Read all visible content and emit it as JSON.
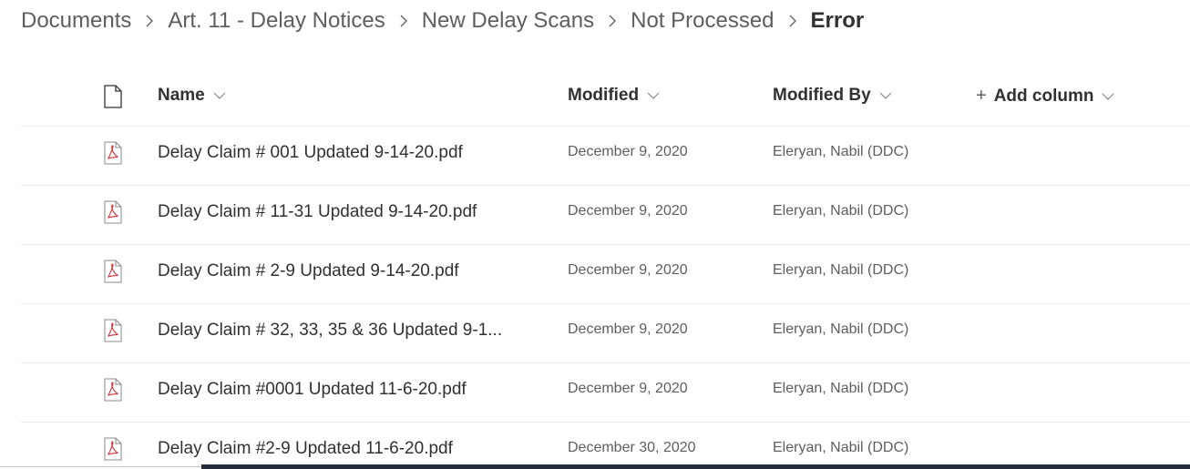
{
  "breadcrumb": {
    "items": [
      "Documents",
      "Art. 11 - Delay Notices",
      "New Delay Scans",
      "Not Processed"
    ],
    "current": "Error"
  },
  "columns": {
    "name": "Name",
    "modified": "Modified",
    "modified_by": "Modified By",
    "add_column": "Add column"
  },
  "icons": {
    "file_header": "document-icon",
    "row_file": "pdf-icon",
    "pdf_accent": "#d13438"
  },
  "rows": [
    {
      "name": "Delay Claim # 001 Updated 9-14-20.pdf",
      "modified": "December 9, 2020",
      "modified_by": "Eleryan, Nabil (DDC)"
    },
    {
      "name": "Delay Claim # 11-31 Updated 9-14-20.pdf",
      "modified": "December 9, 2020",
      "modified_by": "Eleryan, Nabil (DDC)"
    },
    {
      "name": "Delay Claim # 2-9 Updated 9-14-20.pdf",
      "modified": "December 9, 2020",
      "modified_by": "Eleryan, Nabil (DDC)"
    },
    {
      "name": "Delay Claim # 32, 33, 35 & 36 Updated 9-1...",
      "modified": "December 9, 2020",
      "modified_by": "Eleryan, Nabil (DDC)"
    },
    {
      "name": "Delay Claim #0001 Updated 11-6-20.pdf",
      "modified": "December 9, 2020",
      "modified_by": "Eleryan, Nabil (DDC)"
    },
    {
      "name": "Delay Claim #2-9 Updated 11-6-20.pdf",
      "modified": "December 30, 2020",
      "modified_by": "Eleryan, Nabil (DDC)"
    }
  ]
}
